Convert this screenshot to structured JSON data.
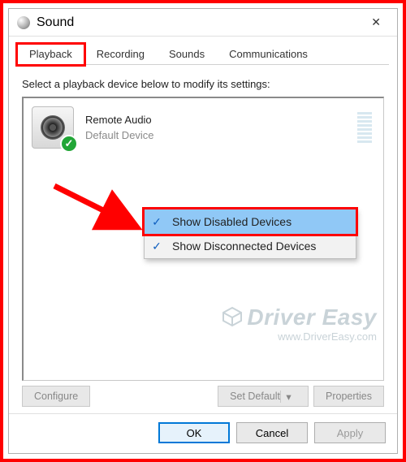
{
  "window": {
    "title": "Sound"
  },
  "tabs": {
    "playback": "Playback",
    "recording": "Recording",
    "sounds": "Sounds",
    "communications": "Communications"
  },
  "instruction": "Select a playback device below to modify its settings:",
  "device": {
    "name": "Remote Audio",
    "status": "Default Device"
  },
  "context_menu": {
    "show_disabled": "Show Disabled Devices",
    "show_disconnected": "Show Disconnected Devices"
  },
  "buttons": {
    "configure": "Configure",
    "set_default": "Set Default",
    "properties": "Properties",
    "ok": "OK",
    "cancel": "Cancel",
    "apply": "Apply"
  },
  "watermark": {
    "brand": "Driver Easy",
    "url": "www.DriverEasy.com"
  },
  "annotations": {
    "highlight_tab": "Playback",
    "highlight_menu_item": "Show Disabled Devices",
    "arrow": true
  }
}
